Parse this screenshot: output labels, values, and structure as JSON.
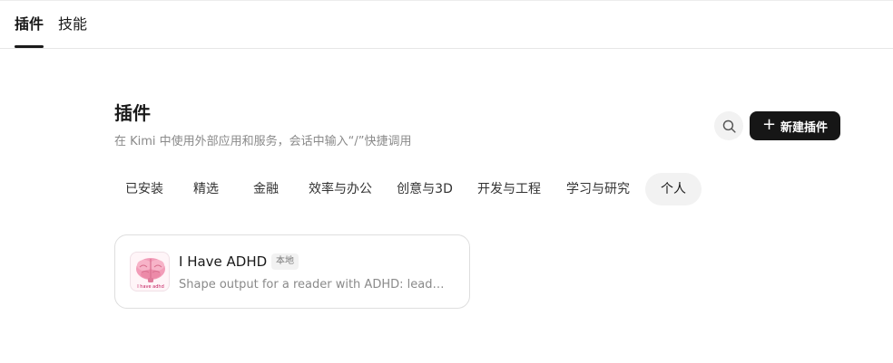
{
  "top_tabs": [
    {
      "label": "插件",
      "active": true
    },
    {
      "label": "技能",
      "active": false
    }
  ],
  "header": {
    "title": "插件",
    "subtitle": "在 Kimi 中使用外部应用和服务，会话中输入“/”快捷调用"
  },
  "actions": {
    "search_icon": "search-icon",
    "new_label": "新建插件",
    "new_icon": "plus-icon"
  },
  "categories": [
    {
      "label": "已安装",
      "active": false
    },
    {
      "label": "精选",
      "active": false
    },
    {
      "label": "金融",
      "active": false
    },
    {
      "label": "效率与办公",
      "active": false
    },
    {
      "label": "创意与3D",
      "active": false
    },
    {
      "label": "开发与工程",
      "active": false
    },
    {
      "label": "学习与研究",
      "active": false
    },
    {
      "label": "个人",
      "active": true
    }
  ],
  "plugins": [
    {
      "name": "I Have ADHD",
      "badge": "本地",
      "description": "Shape output for a reader with ADHD: lead with the answer, keep it short",
      "icon": "brain-icon",
      "icon_caption": "I have adhd"
    }
  ],
  "colors": {
    "primary_button": "#161616",
    "active_chip": "#f2f2f2",
    "muted_text": "#8a8a8a"
  }
}
